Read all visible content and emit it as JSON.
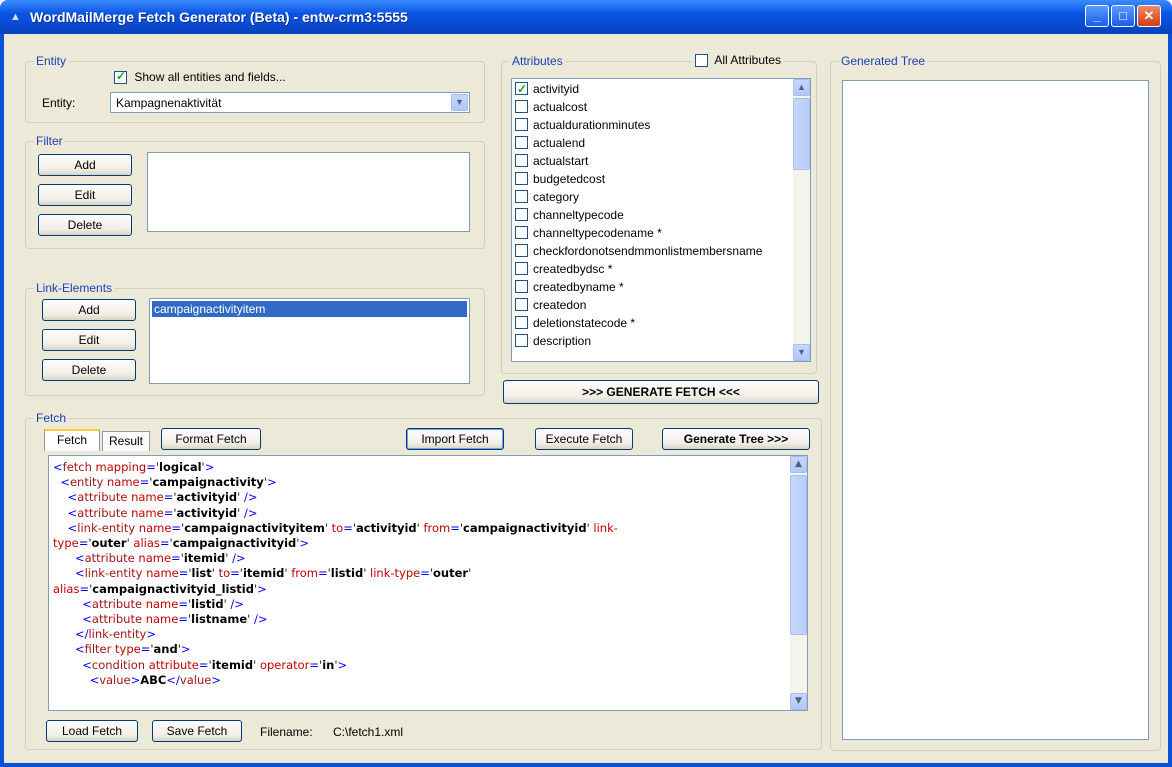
{
  "window": {
    "title": "WordMailMerge Fetch Generator (Beta) - entw-crm3:5555",
    "controls": {
      "minimize": "_",
      "maximize": "□",
      "close": "✕"
    }
  },
  "entity": {
    "group_label": "Entity",
    "show_all_label": "Show all entities and fields...",
    "show_all_checked": true,
    "entity_label": "Entity:",
    "entity_value": "Kampagnenaktivität"
  },
  "filter": {
    "group_label": "Filter",
    "add_label": "Add",
    "edit_label": "Edit",
    "delete_label": "Delete"
  },
  "link_elements": {
    "group_label": "Link-Elements",
    "add_label": "Add",
    "edit_label": "Edit",
    "delete_label": "Delete",
    "items": [
      "campaignactivityitem"
    ]
  },
  "attributes": {
    "group_label": "Attributes",
    "all_label": "All Attributes",
    "items": [
      {
        "label": "activityid",
        "checked": true
      },
      {
        "label": "actualcost",
        "checked": false
      },
      {
        "label": "actualdurationminutes",
        "checked": false
      },
      {
        "label": "actualend",
        "checked": false
      },
      {
        "label": "actualstart",
        "checked": false
      },
      {
        "label": "budgetedcost",
        "checked": false
      },
      {
        "label": "category",
        "checked": false
      },
      {
        "label": "channeltypecode",
        "checked": false
      },
      {
        "label": "channeltypecodename *",
        "checked": false
      },
      {
        "label": "checkfordonotsendmmonlistmembersname",
        "checked": false
      },
      {
        "label": "createdbydsc *",
        "checked": false
      },
      {
        "label": "createdbyname *",
        "checked": false
      },
      {
        "label": "createdon",
        "checked": false
      },
      {
        "label": "deletionstatecode *",
        "checked": false
      },
      {
        "label": "description",
        "checked": false
      }
    ]
  },
  "generate_fetch_label": ">>> GENERATE FETCH <<<",
  "fetch": {
    "group_label": "Fetch",
    "tabs": [
      "Fetch",
      "Result"
    ],
    "format_label": "Format Fetch",
    "import_label": "Import Fetch",
    "execute_label": "Execute Fetch",
    "generate_tree_label": "Generate Tree >>>",
    "load_label": "Load Fetch",
    "save_label": "Save Fetch",
    "filename_label": "Filename:",
    "filename_value": "C:\\fetch1.xml",
    "lines": [
      [
        [
          "p",
          "<"
        ],
        [
          "t",
          "fetch "
        ],
        [
          "a",
          "mapping"
        ],
        [
          "p",
          "="
        ],
        [
          "q",
          "'"
        ],
        [
          "v",
          "logical"
        ],
        [
          "q",
          "'"
        ],
        [
          "p",
          ">"
        ]
      ],
      [
        [
          "x",
          "  "
        ],
        [
          "p",
          "<"
        ],
        [
          "t",
          "entity "
        ],
        [
          "a",
          "name"
        ],
        [
          "p",
          "="
        ],
        [
          "q",
          "'"
        ],
        [
          "v",
          "campaignactivity"
        ],
        [
          "q",
          "'"
        ],
        [
          "p",
          ">"
        ]
      ],
      [
        [
          "x",
          "    "
        ],
        [
          "p",
          "<"
        ],
        [
          "t",
          "attribute "
        ],
        [
          "a",
          "name"
        ],
        [
          "p",
          "="
        ],
        [
          "q",
          "'"
        ],
        [
          "v",
          "activityid"
        ],
        [
          "q",
          "'"
        ],
        [
          "p",
          " />"
        ]
      ],
      [
        [
          "x",
          "    "
        ],
        [
          "p",
          "<"
        ],
        [
          "t",
          "attribute "
        ],
        [
          "a",
          "name"
        ],
        [
          "p",
          "="
        ],
        [
          "q",
          "'"
        ],
        [
          "v",
          "activityid"
        ],
        [
          "q",
          "'"
        ],
        [
          "p",
          " />"
        ]
      ],
      [
        [
          "x",
          "    "
        ],
        [
          "p",
          "<"
        ],
        [
          "t",
          "link-entity "
        ],
        [
          "a",
          "name"
        ],
        [
          "p",
          "="
        ],
        [
          "q",
          "'"
        ],
        [
          "v",
          "campaignactivityitem"
        ],
        [
          "q",
          "' "
        ],
        [
          "a",
          "to"
        ],
        [
          "p",
          "="
        ],
        [
          "q",
          "'"
        ],
        [
          "v",
          "activityid"
        ],
        [
          "q",
          "' "
        ],
        [
          "a",
          "from"
        ],
        [
          "p",
          "="
        ],
        [
          "q",
          "'"
        ],
        [
          "v",
          "campaignactivityid"
        ],
        [
          "q",
          "' "
        ],
        [
          "a",
          "link-"
        ]
      ],
      [
        [
          "a",
          "type"
        ],
        [
          "p",
          "="
        ],
        [
          "q",
          "'"
        ],
        [
          "v",
          "outer"
        ],
        [
          "q",
          "' "
        ],
        [
          "a",
          "alias"
        ],
        [
          "p",
          "="
        ],
        [
          "q",
          "'"
        ],
        [
          "v",
          "campaignactivityid"
        ],
        [
          "q",
          "'"
        ],
        [
          "p",
          ">"
        ]
      ],
      [
        [
          "x",
          "      "
        ],
        [
          "p",
          "<"
        ],
        [
          "t",
          "attribute "
        ],
        [
          "a",
          "name"
        ],
        [
          "p",
          "="
        ],
        [
          "q",
          "'"
        ],
        [
          "v",
          "itemid"
        ],
        [
          "q",
          "'"
        ],
        [
          "p",
          " />"
        ]
      ],
      [
        [
          "x",
          "      "
        ],
        [
          "p",
          "<"
        ],
        [
          "t",
          "link-entity "
        ],
        [
          "a",
          "name"
        ],
        [
          "p",
          "="
        ],
        [
          "q",
          "'"
        ],
        [
          "v",
          "list"
        ],
        [
          "q",
          "' "
        ],
        [
          "a",
          "to"
        ],
        [
          "p",
          "="
        ],
        [
          "q",
          "'"
        ],
        [
          "v",
          "itemid"
        ],
        [
          "q",
          "' "
        ],
        [
          "a",
          "from"
        ],
        [
          "p",
          "="
        ],
        [
          "q",
          "'"
        ],
        [
          "v",
          "listid"
        ],
        [
          "q",
          "' "
        ],
        [
          "a",
          "link-type"
        ],
        [
          "p",
          "="
        ],
        [
          "q",
          "'"
        ],
        [
          "v",
          "outer"
        ],
        [
          "q",
          "'"
        ]
      ],
      [
        [
          "a",
          "alias"
        ],
        [
          "p",
          "="
        ],
        [
          "q",
          "'"
        ],
        [
          "v",
          "campaignactivityid_listid"
        ],
        [
          "q",
          "'"
        ],
        [
          "p",
          ">"
        ]
      ],
      [
        [
          "x",
          "        "
        ],
        [
          "p",
          "<"
        ],
        [
          "t",
          "attribute "
        ],
        [
          "a",
          "name"
        ],
        [
          "p",
          "="
        ],
        [
          "q",
          "'"
        ],
        [
          "v",
          "listid"
        ],
        [
          "q",
          "'"
        ],
        [
          "p",
          " />"
        ]
      ],
      [
        [
          "x",
          "        "
        ],
        [
          "p",
          "<"
        ],
        [
          "t",
          "attribute "
        ],
        [
          "a",
          "name"
        ],
        [
          "p",
          "="
        ],
        [
          "q",
          "'"
        ],
        [
          "v",
          "listname"
        ],
        [
          "q",
          "'"
        ],
        [
          "p",
          " />"
        ]
      ],
      [
        [
          "x",
          "      "
        ],
        [
          "p",
          "</"
        ],
        [
          "t",
          "link-entity"
        ],
        [
          "p",
          ">"
        ]
      ],
      [
        [
          "x",
          "      "
        ],
        [
          "p",
          "<"
        ],
        [
          "t",
          "filter "
        ],
        [
          "a",
          "type"
        ],
        [
          "p",
          "="
        ],
        [
          "q",
          "'"
        ],
        [
          "v",
          "and"
        ],
        [
          "q",
          "'"
        ],
        [
          "p",
          ">"
        ]
      ],
      [
        [
          "x",
          "        "
        ],
        [
          "p",
          "<"
        ],
        [
          "t",
          "condition "
        ],
        [
          "a",
          "attribute"
        ],
        [
          "p",
          "="
        ],
        [
          "q",
          "'"
        ],
        [
          "v",
          "itemid"
        ],
        [
          "q",
          "' "
        ],
        [
          "a",
          "operator"
        ],
        [
          "p",
          "="
        ],
        [
          "q",
          "'"
        ],
        [
          "v",
          "in"
        ],
        [
          "q",
          "'"
        ],
        [
          "p",
          ">"
        ]
      ],
      [
        [
          "x",
          "          "
        ],
        [
          "p",
          "<"
        ],
        [
          "t",
          "value"
        ],
        [
          "p",
          ">"
        ],
        [
          "v",
          "ABC"
        ],
        [
          "p",
          "</"
        ],
        [
          "t",
          "value"
        ],
        [
          "p",
          ">"
        ]
      ]
    ]
  },
  "tree": {
    "group_label": "Generated Tree"
  }
}
